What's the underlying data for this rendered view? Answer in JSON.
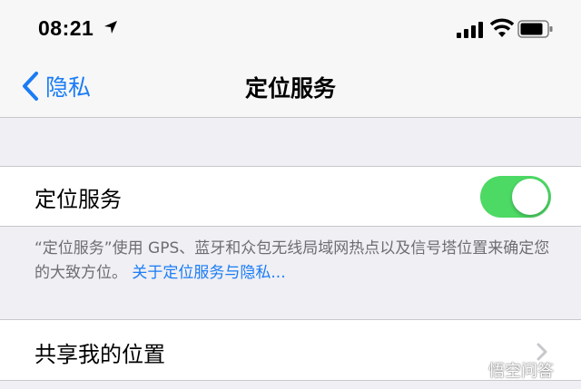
{
  "status_bar": {
    "time": "08:21",
    "icons": [
      "location-arrow-icon",
      "cellular-signal-icon",
      "wifi-icon",
      "battery-icon"
    ]
  },
  "nav": {
    "back_label": "隐私",
    "title": "定位服务"
  },
  "location_services": {
    "label": "定位服务",
    "toggle_on": true,
    "footer_text": "“定位服务”使用 GPS、蓝牙和众包无线局域网热点以及信号塔位置来确定您的大致方位。",
    "footer_link": "关于定位服务与隐私..."
  },
  "share_location": {
    "label": "共享我的位置"
  },
  "watermark": {
    "text": "悟空问答"
  },
  "colors": {
    "accent": "#1a7cf5",
    "toggle_on": "#4cd964",
    "background": "#efeff4"
  }
}
